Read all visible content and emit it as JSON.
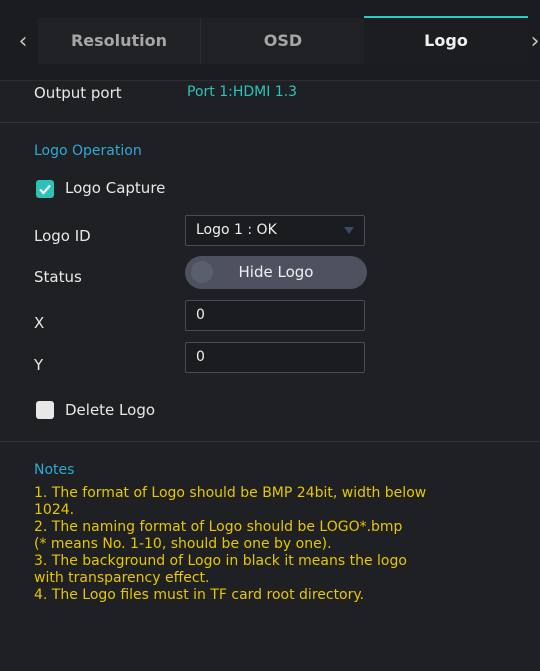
{
  "tabs": {
    "items": [
      {
        "label": "Resolution"
      },
      {
        "label": "OSD"
      },
      {
        "label": "Logo"
      }
    ],
    "active": "Logo"
  },
  "output_port": {
    "label": "Output port",
    "value": "Port 1:HDMI 1.3"
  },
  "logo_operation": {
    "title": "Logo Operation",
    "capture": {
      "label": "Logo Capture",
      "checked": true
    },
    "logo_id": {
      "label": "Logo ID",
      "value": "Logo 1 : OK"
    },
    "status": {
      "label": "Status",
      "toggle_label": "Hide Logo"
    },
    "x": {
      "label": "X",
      "value": "0"
    },
    "y": {
      "label": "Y",
      "value": "0"
    },
    "delete": {
      "label": "Delete Logo",
      "checked": false
    }
  },
  "notes": {
    "title": "Notes",
    "lines": [
      "1. The format of Logo should be BMP 24bit, width below",
      "1024.",
      "2. The naming format of Logo should be LOGO*.bmp",
      "(* means No. 1-10,  should be one by one).",
      "3. The background of Logo in black it means the logo",
      "with transparency effect.",
      "4. The Logo files must in TF card root directory."
    ]
  },
  "colors": {
    "accent": "#2dc3bc",
    "section": "#2fa9d7",
    "notes": "#e6c700"
  },
  "icons": [
    "chevron-left-icon",
    "chevron-right-icon",
    "checkmark-icon",
    "dropdown-arrow-icon"
  ]
}
